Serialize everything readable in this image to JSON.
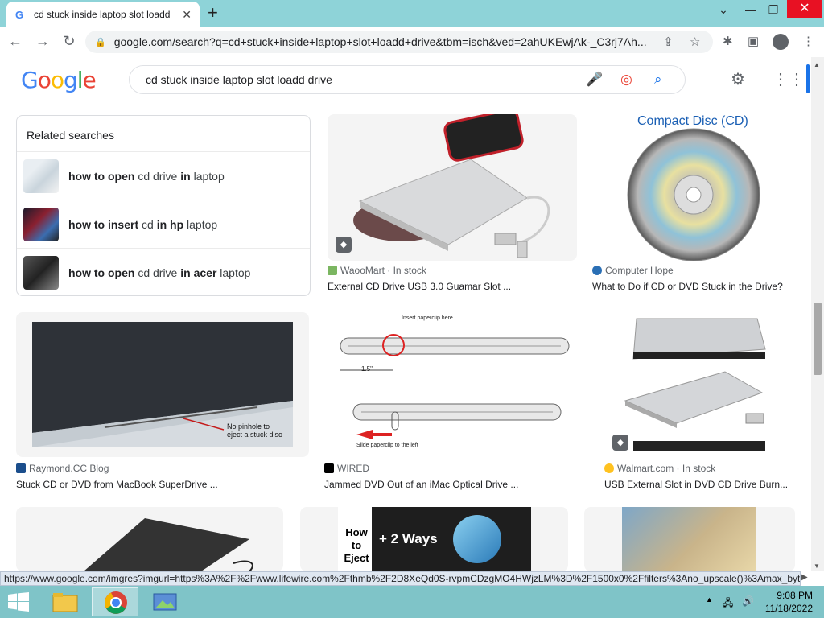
{
  "browser": {
    "tab_title": "cd stuck inside laptop slot loadd",
    "url": "google.com/search?q=cd+stuck+inside+laptop+slot+loadd+drive&tbm=isch&ved=2ahUKEwjAk-_C3rj7Ah..."
  },
  "google": {
    "query": "cd stuck inside laptop slot loadd drive"
  },
  "related": {
    "title": "Related searches",
    "items": [
      {
        "b1": "how to open",
        "t1": " cd drive ",
        "b2": "in",
        "t2": " laptop"
      },
      {
        "b1": "how to insert",
        "t1": " cd ",
        "b2": "in hp",
        "t2": " laptop"
      },
      {
        "b1": "how to open",
        "t1": " cd drive ",
        "b2": "in acer",
        "t2": " laptop"
      }
    ]
  },
  "results": [
    {
      "source": "WaooMart · In stock",
      "title": "External CD Drive USB 3.0 Guamar Slot ..."
    },
    {
      "source": "Computer Hope",
      "title": "What to Do if CD or DVD Stuck in the Drive?",
      "image_text": "Compact Disc (CD)"
    },
    {
      "source": "Raymond.CC Blog",
      "title": "Stuck CD or DVD from MacBook SuperDrive ...",
      "image_text": "No pinhole to eject a stuck disc"
    },
    {
      "source": "WIRED",
      "title": "Jammed DVD Out of an iMac Optical Drive ...",
      "image_text_top": "Insert paperclip here",
      "image_text_dim": "1.5\"",
      "image_text_bottom": "Slide paperclip to the left"
    },
    {
      "source": "Walmart.com · In stock",
      "title": "USB External Slot in DVD CD Drive Burn..."
    },
    {
      "image_text": "How to Eject",
      "image_text2": "+ 2 Ways"
    }
  ],
  "status_url": "https://www.google.com/imgres?imgurl=https%3A%2F%2Fwww.lifewire.com%2Fthmb%2F2D8XeQd0S-rvpmCDzgMO4HWjzLM%3D%2F1500x0%2Ffilters%3Ano_upscale()%3Amax_byt...",
  "taskbar": {
    "time": "9:08 PM",
    "date": "11/18/2022"
  }
}
